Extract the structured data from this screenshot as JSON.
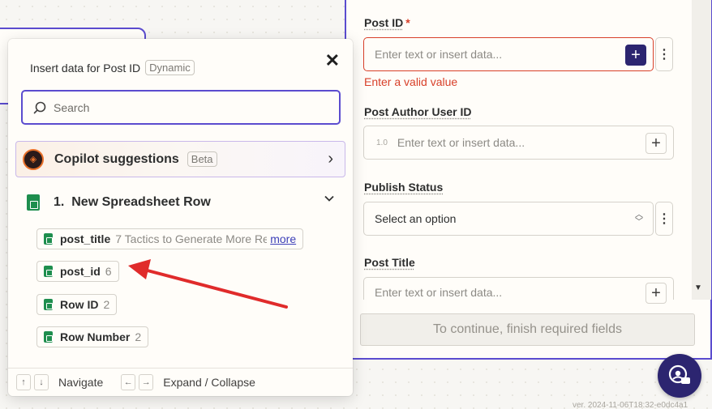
{
  "popup": {
    "title": "Insert data for Post ID",
    "title_tag": "Dynamic",
    "search_placeholder": "Search",
    "copilot": {
      "label": "Copilot suggestions",
      "tag": "Beta"
    },
    "step": {
      "number": "1.",
      "label": "New Spreadsheet Row"
    },
    "items": [
      {
        "key": "post_title",
        "value": "7 Tactics to Generate More Re",
        "more": "more"
      },
      {
        "key": "post_id",
        "value": "6"
      },
      {
        "key": "Row ID",
        "value": "2"
      },
      {
        "key": "Row Number",
        "value": "2"
      }
    ],
    "footer": {
      "navigate_label": "Navigate",
      "expand_label": "Expand / Collapse",
      "keys": {
        "up": "↑",
        "down": "↓",
        "left": "←",
        "right": "→"
      }
    }
  },
  "form": {
    "post_id": {
      "label": "Post ID",
      "required_mark": "*",
      "placeholder": "Enter text or insert data...",
      "error": "Enter a valid value"
    },
    "post_author": {
      "label": "Post Author User ID",
      "type_icon": "1.0",
      "placeholder": "Enter text or insert data..."
    },
    "publish_status": {
      "label": "Publish Status",
      "value": "Select an option"
    },
    "post_title": {
      "label": "Post Title",
      "placeholder": "Enter text or insert data..."
    },
    "continue_button": "To continue, finish required fields"
  },
  "version": "ver. 2024-11-06T18:32-e0dc4a1",
  "colors": {
    "accent": "#5b4ccf",
    "error": "#d8402a",
    "dark_button": "#2c2570",
    "sheets_green": "#1e8e4e",
    "annotation_arrow": "#e02b2b"
  },
  "icons": [
    "close-icon",
    "search-icon",
    "copilot-icon",
    "chevron-right-icon",
    "chevron-down-icon",
    "sheets-icon",
    "plus-icon",
    "kebab-icon",
    "select-arrows-icon",
    "help-icon"
  ]
}
